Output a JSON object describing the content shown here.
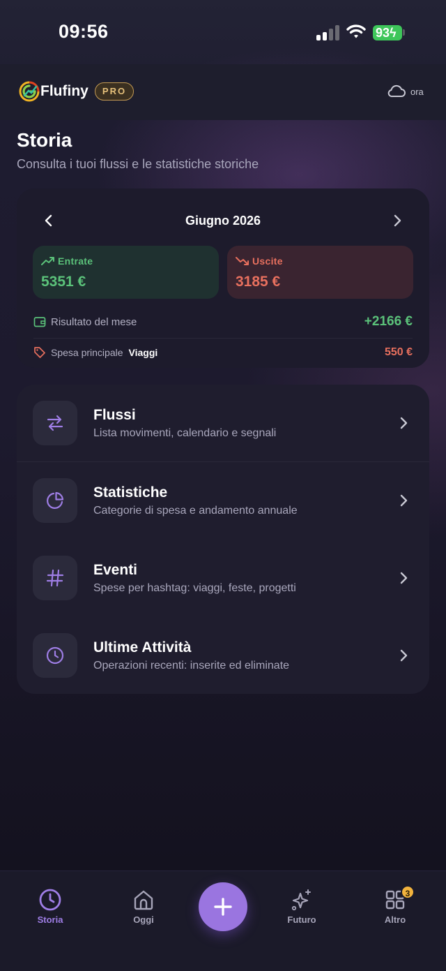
{
  "status_bar": {
    "time": "09:56",
    "battery": "93"
  },
  "header": {
    "app_name": "Flufiny",
    "plan_badge": "PRO",
    "sync_label": "ora"
  },
  "page": {
    "title": "Storia",
    "subtitle": "Consulta i tuoi flussi e le statistiche storiche"
  },
  "summary": {
    "month": "Giugno 2026",
    "income": {
      "label": "Entrate",
      "value": "5351 €"
    },
    "expenses": {
      "label": "Uscite",
      "value": "3185 €"
    },
    "result": {
      "label": "Risultato del mese",
      "value": "+2166 €"
    },
    "top_spend": {
      "label": "Spesa principale",
      "category": "Viaggi",
      "value": "550 €"
    }
  },
  "menu": [
    {
      "title": "Flussi",
      "description": "Lista movimenti, calendario e segnali",
      "icon": "arrows-exchange-icon"
    },
    {
      "title": "Statistiche",
      "description": "Categorie di spesa e andamento annuale",
      "icon": "pie-chart-icon"
    },
    {
      "title": "Eventi",
      "description": "Spese per hashtag: viaggi, feste, progetti",
      "icon": "hashtag-icon"
    },
    {
      "title": "Ultime Attività",
      "description": "Operazioni recenti: inserite ed eliminate",
      "icon": "clock-icon"
    }
  ],
  "tabbar": {
    "items": [
      {
        "label": "Storia",
        "icon": "clock-icon",
        "active": true
      },
      {
        "label": "Oggi",
        "icon": "home-icon",
        "active": false
      },
      {
        "label": "Futuro",
        "icon": "sparkles-icon",
        "active": false
      },
      {
        "label": "Altro",
        "icon": "grid-icon",
        "active": false
      }
    ],
    "add_icon": "plus-icon",
    "altro_badge": "3"
  },
  "colors": {
    "accent": "#9a75e0",
    "income": "#5bc27a",
    "expense": "#e8705e",
    "badge": "#f2b33d"
  }
}
